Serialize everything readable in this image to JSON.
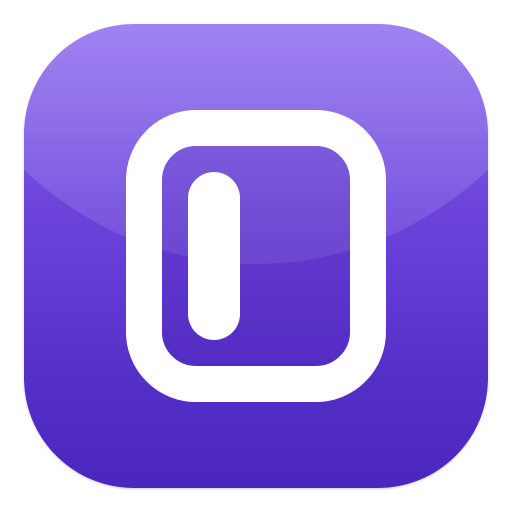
{
  "icon": {
    "name": "sidebar-toggle-app-icon",
    "colors": {
      "top": "#8e6cf0",
      "bottom": "#4a25be",
      "glyph": "#ffffff"
    }
  }
}
